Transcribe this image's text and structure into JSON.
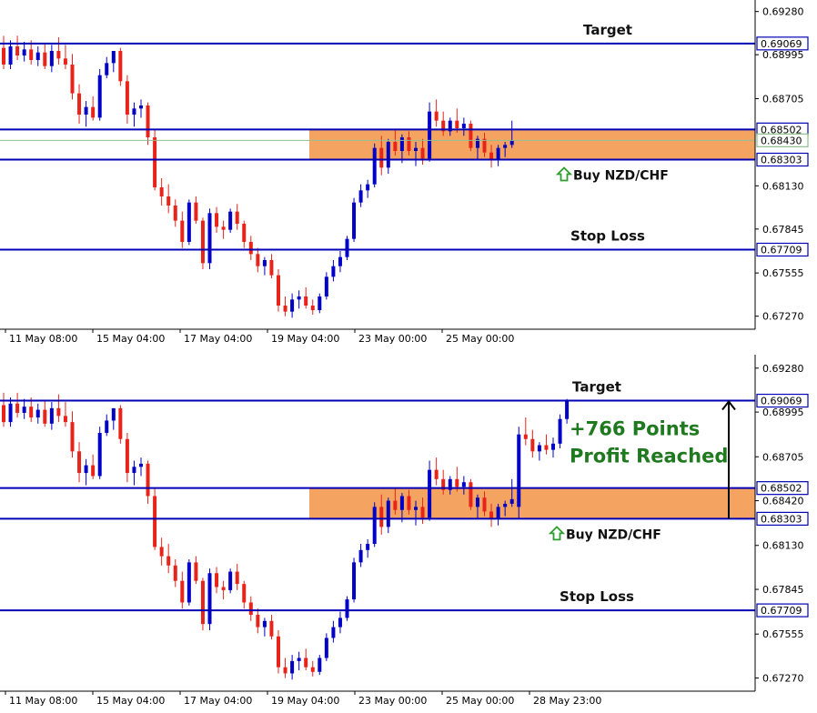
{
  "colors": {
    "level_line": "#0000b4",
    "zone_fill": "#f4a460",
    "bull_candle": "#0000c8",
    "bear_candle": "#e8231a",
    "current_price_line": "#8fbf8f",
    "profit_text": "#1f7a1f",
    "buy_arrow": "#2e9e2e"
  },
  "icons": {
    "buy_arrow": "up-arrow-outline-icon",
    "profit_arrow": "vertical-up-arrow-icon"
  },
  "chart_data": [
    {
      "type": "candlestick",
      "symbol_annotation": "Buy NZD/CHF",
      "price_axis_ticks": [
        "0.69280",
        "0.68995",
        "0.68705",
        "0.68130",
        "0.67845",
        "0.67555",
        "0.67270"
      ],
      "time_axis_ticks": [
        "11 May 08:00",
        "15 May 04:00",
        "17 May 04:00",
        "19 May 04:00",
        "23 May 00:00",
        "25 May 00:00"
      ],
      "levels": [
        {
          "name": "Target",
          "price": "0.69069",
          "label": "Target"
        },
        {
          "name": "Zone top",
          "price": "0.68502",
          "label": ""
        },
        {
          "name": "Current price",
          "price": "0.68430",
          "label": ""
        },
        {
          "name": "Zone bottom",
          "price": "0.68303",
          "label": ""
        },
        {
          "name": "Stop Loss",
          "price": "0.67709",
          "label": "Stop Loss"
        }
      ],
      "buy_zone": [
        0.68303,
        0.68502
      ],
      "ylim": [
        0.6722,
        0.6932
      ],
      "candles_ohlc_approx": "see script"
    },
    {
      "type": "candlestick",
      "symbol_annotation": "Buy NZD/CHF",
      "profit_annotation_line1": "+766 Points",
      "profit_annotation_line2": "Profit Reached",
      "price_axis_ticks": [
        "0.69280",
        "0.68995",
        "0.68705",
        "0.68420",
        "0.68130",
        "0.67845",
        "0.67555",
        "0.67270"
      ],
      "time_axis_ticks": [
        "11 May 08:00",
        "15 May 04:00",
        "17 May 04:00",
        "19 May 04:00",
        "23 May 00:00",
        "25 May 00:00",
        "28 May 23:00"
      ],
      "levels": [
        {
          "name": "Target",
          "price": "0.69069",
          "label": "Target"
        },
        {
          "name": "Zone top",
          "price": "0.68502",
          "label": ""
        },
        {
          "name": "Zone bottom",
          "price": "0.68303",
          "label": ""
        },
        {
          "name": "Stop Loss",
          "price": "0.67709",
          "label": "Stop Loss"
        }
      ],
      "buy_zone": [
        0.68303,
        0.68502
      ],
      "ylim": [
        0.6722,
        0.6932
      ]
    }
  ]
}
